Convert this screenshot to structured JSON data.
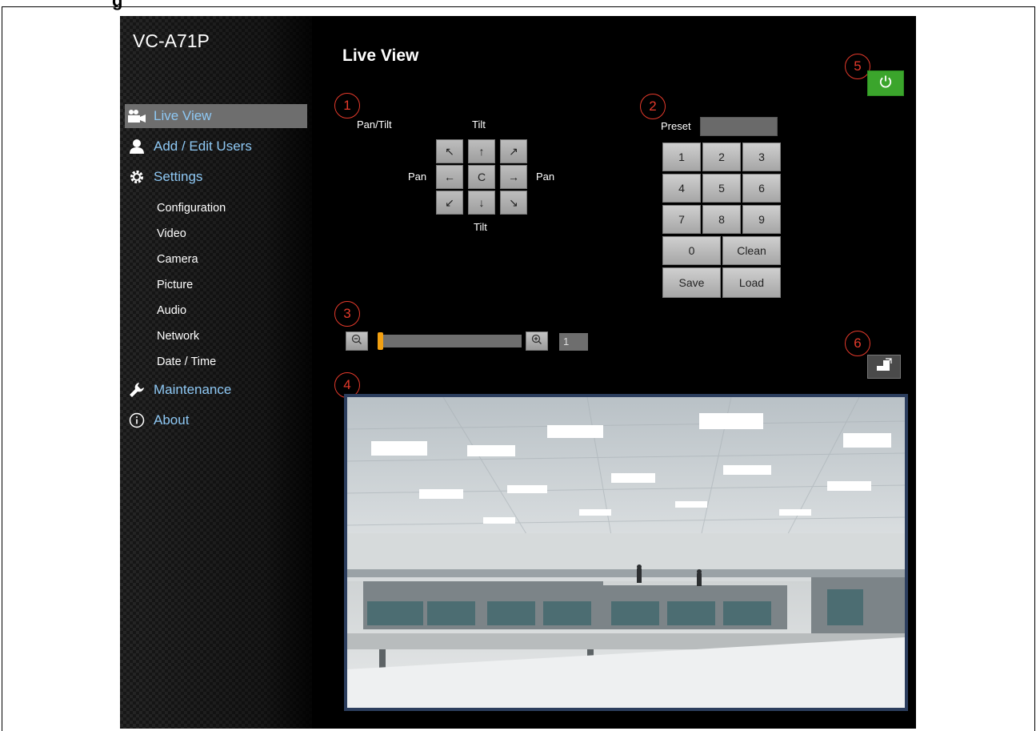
{
  "page_heading_fragment": "g",
  "sidebar": {
    "model_name": "VC-A71P",
    "nav": [
      {
        "label": "Live View",
        "icon": "camera-icon",
        "active": true
      },
      {
        "label": "Add / Edit Users",
        "icon": "user-icon"
      },
      {
        "label": "Settings",
        "icon": "gear-icon"
      }
    ],
    "settings_sub": [
      "Configuration",
      "Video",
      "Camera",
      "Picture",
      "Audio",
      "Network",
      "Date / Time"
    ],
    "nav_bottom": [
      {
        "label": "Maintenance",
        "icon": "wrench-icon"
      },
      {
        "label": "About",
        "icon": "info-icon"
      }
    ]
  },
  "main": {
    "title": "Live View",
    "annotations": [
      "1",
      "2",
      "3",
      "4",
      "5",
      "6"
    ],
    "ptz": {
      "pan_tilt_label": "Pan/Tilt",
      "tilt_top": "Tilt",
      "tilt_bottom": "Tilt",
      "pan_left": "Pan",
      "pan_right": "Pan",
      "buttons": [
        "↖",
        "↑",
        "↗",
        "←",
        "C",
        "→",
        "↙",
        "↓",
        "↘"
      ]
    },
    "preset": {
      "label": "Preset",
      "value": "",
      "keys": [
        "1",
        "2",
        "3",
        "4",
        "5",
        "6",
        "7",
        "8",
        "9"
      ],
      "zero": "0",
      "clean": "Clean",
      "save": "Save",
      "load": "Load"
    },
    "zoom": {
      "value": "1",
      "level_fraction": 0.0
    }
  },
  "colors": {
    "accent_link": "#8ec8f4",
    "annotation_red": "#e53a2b",
    "power_green": "#3ba52c",
    "zoom_handle": "#f2a011"
  }
}
